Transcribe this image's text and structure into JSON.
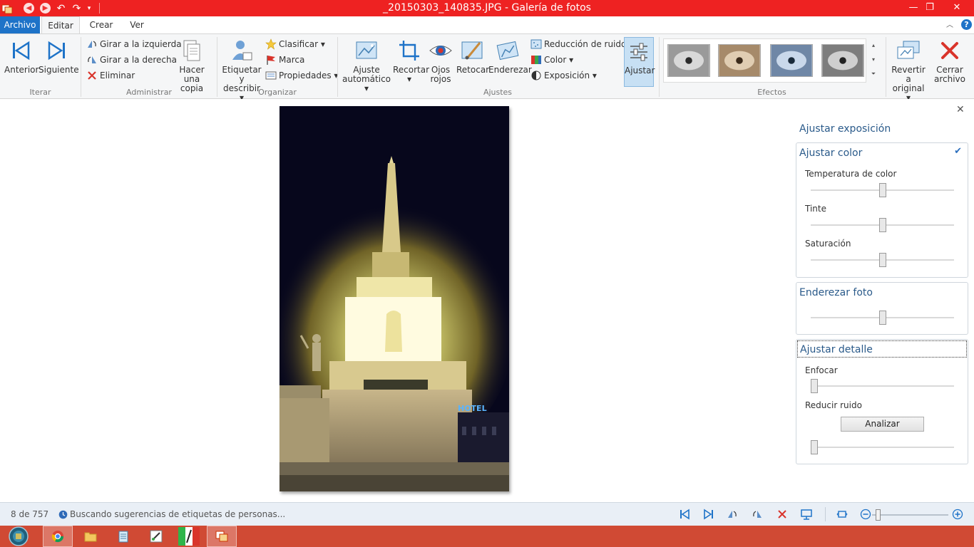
{
  "window": {
    "title": "_20150303_140835.JPG - Galería de fotos"
  },
  "menu": {
    "tabs": [
      "Archivo",
      "Editar",
      "Crear",
      "Ver"
    ],
    "active": "Editar"
  },
  "ribbon": {
    "groups": {
      "iterar": "Iterar",
      "administrar": "Administrar",
      "organizar": "Organizar",
      "ajustes": "Ajustes",
      "efectos": "Efectos"
    },
    "anterior": "Anterior",
    "siguiente": "Siguiente",
    "girar_izq": "Girar a la izquierda",
    "girar_der": "Girar a la derecha",
    "eliminar": "Eliminar",
    "copia_1": "Hacer una",
    "copia_2": "copia",
    "etiquetar_1": "Etiquetar y",
    "etiquetar_2": "describir",
    "clasificar": "Clasificar",
    "marca": "Marca",
    "propiedades": "Propiedades",
    "ajuste_1": "Ajuste",
    "ajuste_2": "automático",
    "recortar": "Recortar",
    "ojos_1": "Ojos",
    "ojos_2": "rojos",
    "retocar": "Retocar",
    "enderezar": "Enderezar",
    "reduccion": "Reducción de ruido",
    "color": "Color",
    "exposicion": "Exposición",
    "ajustar": "Ajustar",
    "revertir_1": "Revertir a",
    "revertir_2": "original",
    "cerrar_1": "Cerrar",
    "cerrar_2": "archivo"
  },
  "panel": {
    "title": "Ajustar exposición",
    "color": {
      "title": "Ajustar color",
      "temperatura": "Temperatura de color",
      "tinte": "Tinte",
      "saturacion": "Saturación",
      "temperatura_value": 0.5,
      "tinte_value": 0.5,
      "saturacion_value": 0.5
    },
    "enderezar": {
      "title": "Enderezar foto",
      "value": 0.5
    },
    "detalle": {
      "title": "Ajustar detalle",
      "enfocar": "Enfocar",
      "reducir": "Reducir ruido",
      "analizar": "Analizar",
      "enfocar_value": 0,
      "reducir_value": 0
    }
  },
  "photo": {
    "hotel_sign": "HOTEL"
  },
  "status": {
    "count": "8 de 757",
    "message": "Buscando sugerencias de etiquetas de personas..."
  }
}
